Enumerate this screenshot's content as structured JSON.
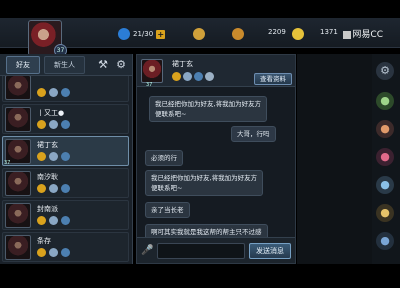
{
  "topbar": {
    "player_level": "37",
    "stamina": "21/30",
    "coins": "2209",
    "gems": "1371",
    "brand": "网易CC"
  },
  "friends": {
    "tabs": [
      "好友",
      "新生人"
    ],
    "items": [
      {
        "name": "",
        "level": "",
        "selected": false
      },
      {
        "name": "丨又工●",
        "level": "",
        "selected": false
      },
      {
        "name": "裙丁玄",
        "level": "37",
        "selected": true
      },
      {
        "name": "南汐耿",
        "level": "",
        "selected": false
      },
      {
        "name": "封南派",
        "level": "",
        "selected": false
      },
      {
        "name": "条存",
        "level": "",
        "selected": false
      }
    ]
  },
  "chat": {
    "contact_name": "裙丁玄",
    "contact_level": "37",
    "view_profile_label": "查看资料",
    "messages": [
      {
        "from": "other",
        "text": "我已经把你加为好友,将我加为好友方",
        "text2": "便联系吧~"
      },
      {
        "from": "me",
        "text": "大哥，行吗"
      },
      {
        "from": "other",
        "text": "必须的行"
      },
      {
        "from": "other",
        "text": "我已经把你加为好友,将我加为好友方",
        "text2": "便联系吧~"
      },
      {
        "from": "other",
        "text": "亲了当长老"
      },
      {
        "from": "other",
        "text": "啊可其实我就是我这帮的帮主只不过感"
      }
    ],
    "send_label": "发送消息"
  },
  "colors": {
    "accent_gold": "#d9a21d",
    "button_blue": "#3a5570",
    "panel_bg": "#1a2129"
  }
}
